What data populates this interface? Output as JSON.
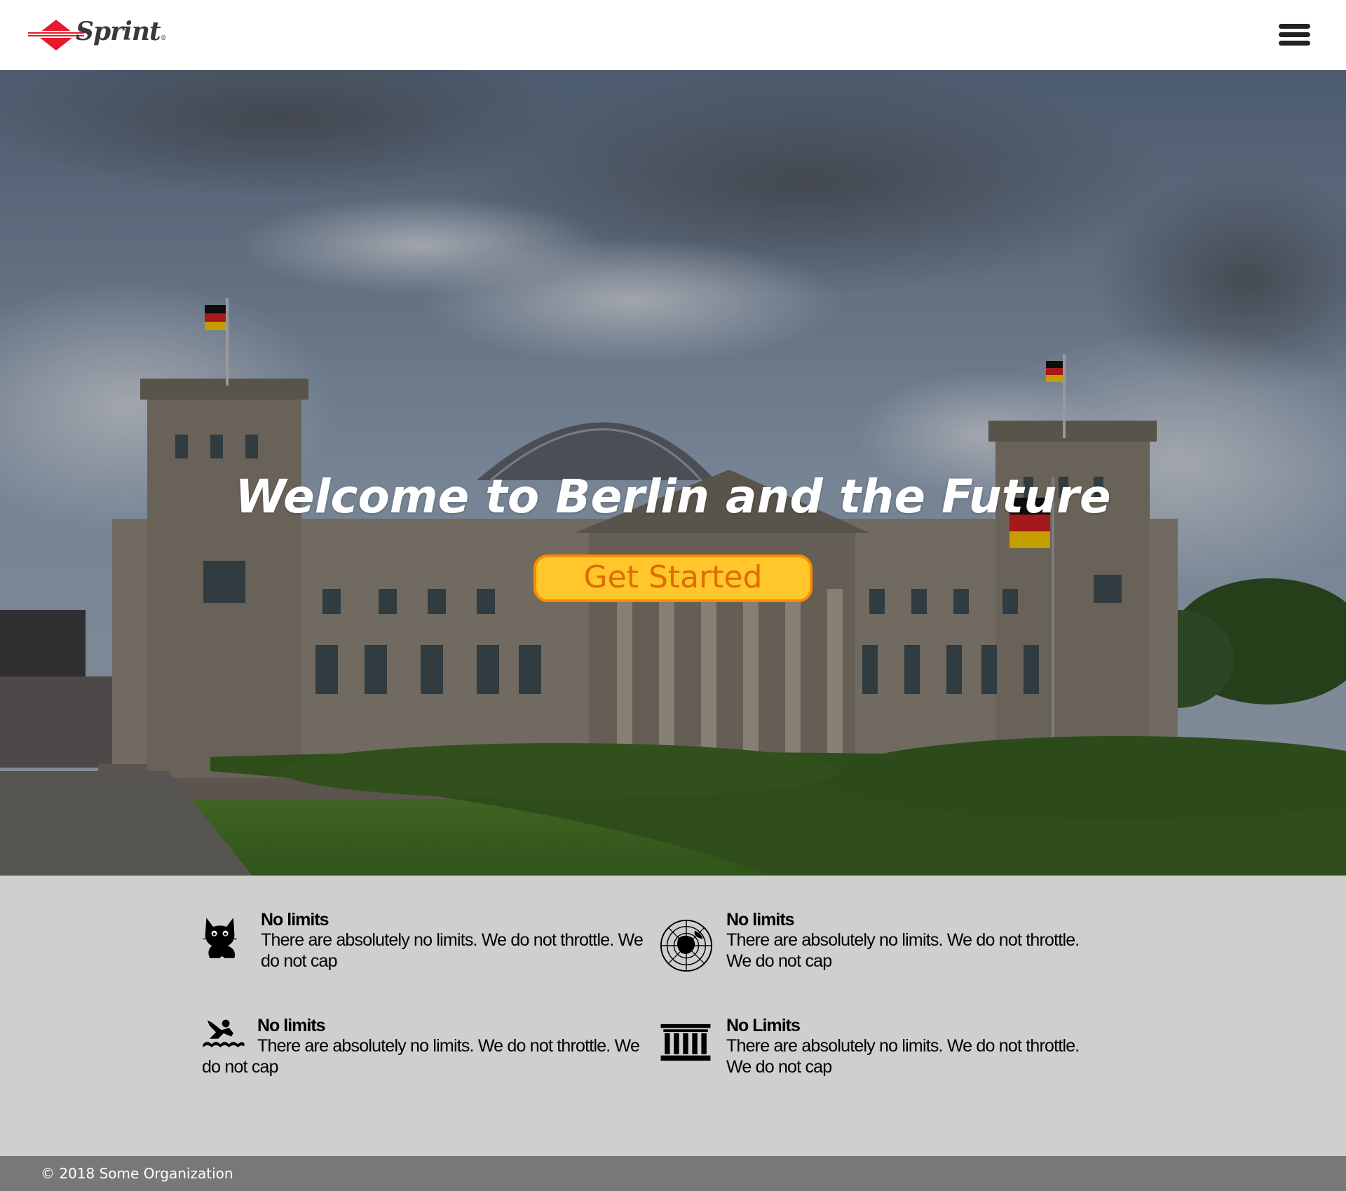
{
  "header": {
    "logo_text": "Sprint",
    "logo_reg": "®",
    "menu_icon": "hamburger-menu-icon"
  },
  "hero": {
    "background": "photo-of-reichstag-building-berlin",
    "title": "Welcome to Berlin and the Future",
    "cta_label": "Get Started",
    "colors": {
      "cta_fill": "#ffc72c",
      "cta_border": "#ff8a00",
      "cta_text": "#e06d00"
    }
  },
  "features": [
    {
      "icon": "cat-icon",
      "title": "No limits",
      "text": "There are absolutely no limits. We do not throttle. We do not cap"
    },
    {
      "icon": "globe-icon",
      "title": "No limits",
      "text": "There are absolutely no limits. We do not throttle. We do not cap"
    },
    {
      "icon": "swimmer-icon",
      "title": "No limits",
      "text": "There are absolutely no limits. We do not throttle. We do not cap"
    },
    {
      "icon": "building-columns-icon",
      "title": "No Limits",
      "text": "There are absolutely no limits. We do not throttle. We do not cap"
    }
  ],
  "footer": {
    "copyright": "© 2018 Some Organization"
  },
  "colors": {
    "features_bg": "#cfcfcf",
    "footer_bg": "#787878",
    "brand_red": "#e8192c"
  }
}
